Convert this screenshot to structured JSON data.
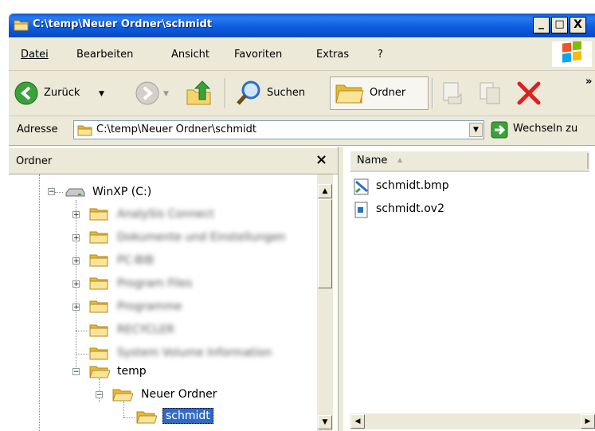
{
  "window": {
    "title": "C:\\temp\\Neuer Ordner\\schmidt",
    "btn_min": "_",
    "btn_max": "□",
    "btn_close": "X"
  },
  "menu": {
    "items": [
      "Datei",
      "Bearbeiten",
      "Ansicht",
      "Favoriten",
      "Extras",
      "?"
    ]
  },
  "toolbar": {
    "back_label": "Zurück",
    "search_label": "Suchen",
    "folders_label": "Ordner",
    "overflow": "»"
  },
  "address": {
    "label": "Adresse",
    "value": "C:\\temp\\Neuer Ordner\\schmidt",
    "go_label": "Wechseln zu"
  },
  "folders": {
    "header": "Ordner",
    "close": "×",
    "drive": "WinXP (C:)",
    "blurred_items": [
      "AnalySis Connect",
      "Dokumente und Einstellungen",
      "PC-BIB",
      "Program Files",
      "Programme",
      "RECYCLER",
      "System Volume Information"
    ],
    "temp": "temp",
    "neuer_ordner": "Neuer Ordner",
    "schmidt": "schmidt"
  },
  "list": {
    "column_name": "Name",
    "files": [
      "schmidt.bmp",
      "schmidt.ov2"
    ]
  },
  "colors": {
    "title_blue": "#0a5bd6",
    "chrome": "#ece9d8",
    "selection": "#316ac5",
    "stop_red": "#e02020",
    "go_green": "#3aa23a"
  }
}
